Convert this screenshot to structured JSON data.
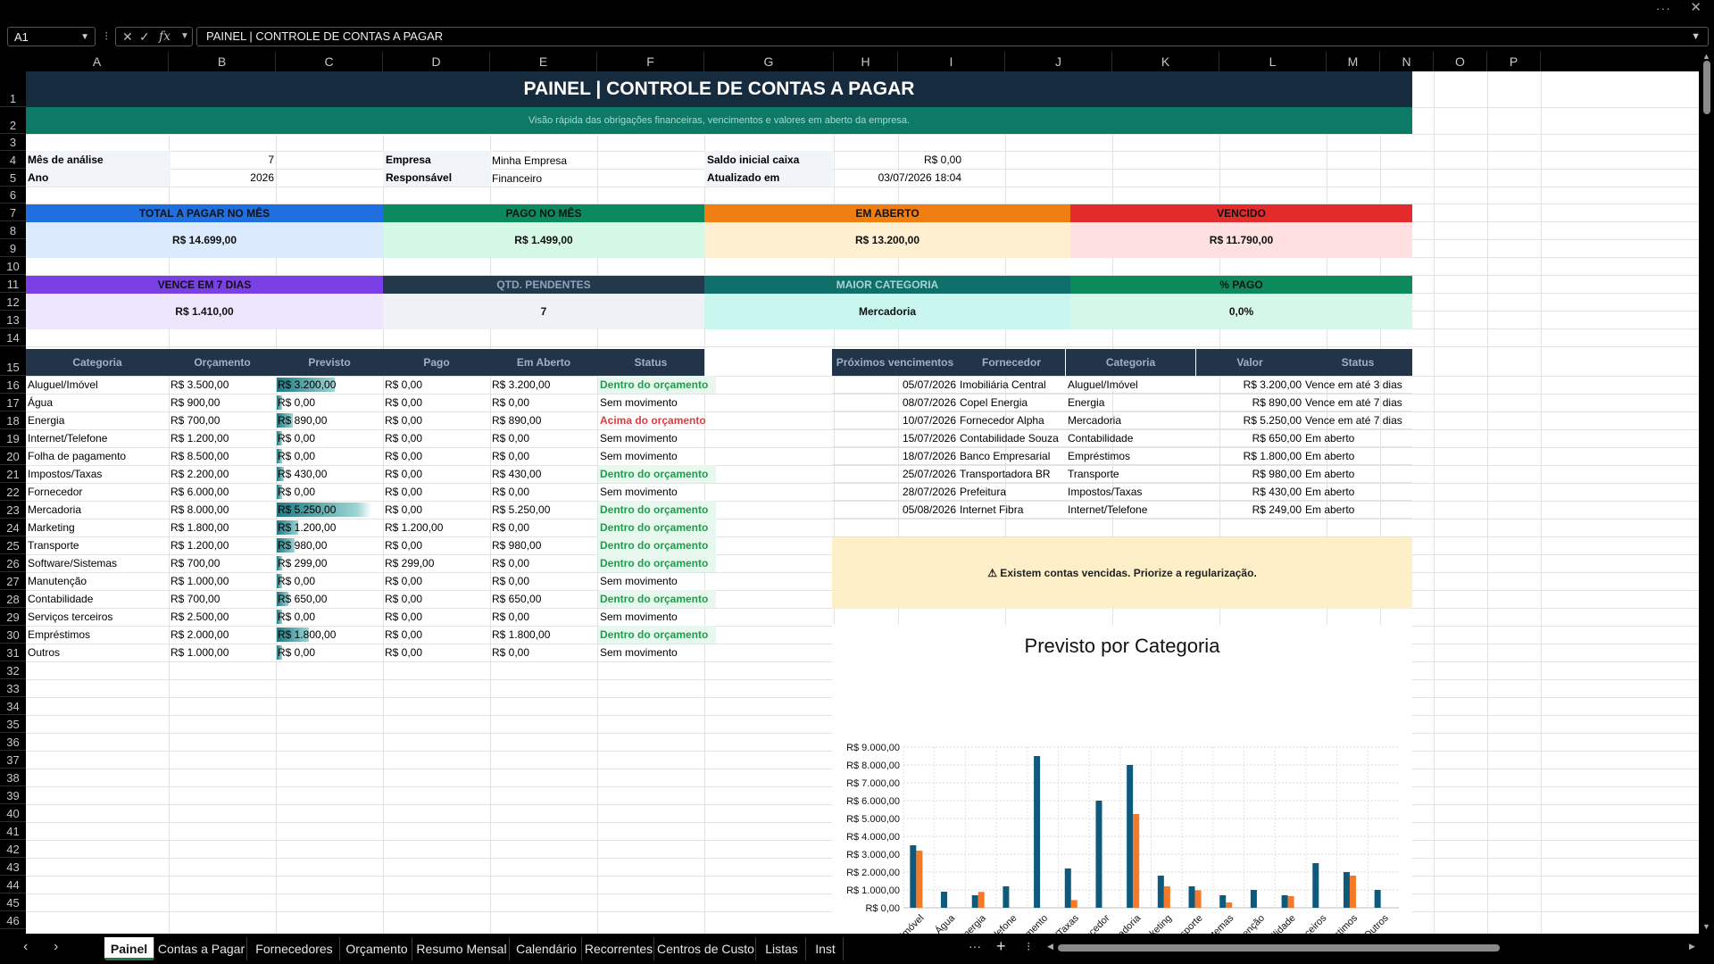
{
  "window": {
    "more_icon": "more-horizontal-icon",
    "close_icon": "close-icon"
  },
  "formula_bar": {
    "name_box": "A1",
    "fx_label": "fx",
    "formula": "PAINEL | CONTROLE DE CONTAS A PAGAR"
  },
  "columns": [
    "A",
    "B",
    "C",
    "D",
    "E",
    "F",
    "G",
    "H",
    "I",
    "J",
    "K",
    "L",
    "M",
    "N",
    "O",
    "P"
  ],
  "rows": [
    "1",
    "2",
    "3",
    "4",
    "5",
    "6",
    "7",
    "8",
    "9",
    "10",
    "11",
    "12",
    "13",
    "14",
    "15",
    "16",
    "17",
    "18",
    "19",
    "20",
    "21",
    "22",
    "23",
    "24",
    "25",
    "26",
    "27",
    "28",
    "29",
    "30",
    "31",
    "32",
    "33",
    "34",
    "35",
    "36",
    "37",
    "38",
    "39",
    "40",
    "41",
    "42",
    "43",
    "44",
    "45",
    "46"
  ],
  "sheet": {
    "title": "PAINEL | CONTROLE DE CONTAS A PAGAR",
    "subtitle": "Visão rápida das obrigações financeiras, vencimentos e valores em aberto da empresa.",
    "info": {
      "mes_label": "Mês de análise",
      "mes_value": "7",
      "ano_label": "Ano",
      "ano_value": "2026",
      "empresa_label": "Empresa",
      "empresa_value": "Minha Empresa",
      "responsavel_label": "Responsável",
      "responsavel_value": "Financeiro",
      "saldo_label": "Saldo inicial caixa",
      "saldo_value": "R$ 0,00",
      "atualizado_label": "Atualizado em",
      "atualizado_value": "03/07/2026 18:04"
    },
    "kpis_row1": [
      {
        "label": "TOTAL A PAGAR NO MÊS",
        "value": "R$ 14.699,00",
        "head_color": "#1f6fe0",
        "body_color": "#dbeafc"
      },
      {
        "label": "PAGO NO MÊS",
        "value": "R$ 1.499,00",
        "head_color": "#0c8a5f",
        "body_color": "#d4f7e6"
      },
      {
        "label": "EM ABERTO",
        "value": "R$ 13.200,00",
        "head_color": "#f07d12",
        "body_color": "#fdefcf"
      },
      {
        "label": "VENCIDO",
        "value": "R$ 11.790,00",
        "head_color": "#e42b2b",
        "body_color": "#fde0df"
      }
    ],
    "kpis_row2": [
      {
        "label": "VENCE EM 7 DIAS",
        "value": "R$ 1.410,00",
        "head_color": "#7b3fe6",
        "body_color": "#ede6fc"
      },
      {
        "label": "QTD. PENDENTES",
        "value": "7",
        "head_color": "#24384b",
        "body_color": "#eef2f6"
      },
      {
        "label": "MAIOR CATEGORIA",
        "value": "Mercadoria",
        "head_color": "#0f6f6a",
        "body_color": "#c9f6ef"
      },
      {
        "label": "% PAGO",
        "value": "0,0%",
        "head_color": "#0d8a5c",
        "body_color": "#d5f7e8"
      }
    ],
    "budget_table": {
      "headers": [
        "Categoria",
        "Orçamento",
        "Previsto",
        "Pago",
        "Em Aberto",
        "Status"
      ],
      "rows": [
        {
          "cat": "Aluguel/Imóvel",
          "orc": "R$ 3.500,00",
          "prev": "R$ 3.200,00",
          "pago": "R$ 0,00",
          "aberto": "R$ 3.200,00",
          "status": "Dentro do orçamento",
          "kind": "ok",
          "bar": 0.61
        },
        {
          "cat": "Água",
          "orc": "R$ 900,00",
          "prev": "R$ 0,00",
          "pago": "R$ 0,00",
          "aberto": "R$ 0,00",
          "status": "Sem movimento",
          "kind": "none",
          "bar": 0.0
        },
        {
          "cat": "Energia",
          "orc": "R$ 700,00",
          "prev": "R$ 890,00",
          "pago": "R$ 0,00",
          "aberto": "R$ 890,00",
          "status": "Acima do orçamento",
          "kind": "over",
          "bar": 0.17
        },
        {
          "cat": "Internet/Telefone",
          "orc": "R$ 1.200,00",
          "prev": "R$ 0,00",
          "pago": "R$ 0,00",
          "aberto": "R$ 0,00",
          "status": "Sem movimento",
          "kind": "none",
          "bar": 0.0
        },
        {
          "cat": "Folha de pagamento",
          "orc": "R$ 8.500,00",
          "prev": "R$ 0,00",
          "pago": "R$ 0,00",
          "aberto": "R$ 0,00",
          "status": "Sem movimento",
          "kind": "none",
          "bar": 0.0
        },
        {
          "cat": "Impostos/Taxas",
          "orc": "R$ 2.200,00",
          "prev": "R$ 430,00",
          "pago": "R$ 0,00",
          "aberto": "R$ 430,00",
          "status": "Dentro do orçamento",
          "kind": "ok",
          "bar": 0.08
        },
        {
          "cat": "Fornecedor",
          "orc": "R$ 6.000,00",
          "prev": "R$ 0,00",
          "pago": "R$ 0,00",
          "aberto": "R$ 0,00",
          "status": "Sem movimento",
          "kind": "none",
          "bar": 0.0
        },
        {
          "cat": "Mercadoria",
          "orc": "R$ 8.000,00",
          "prev": "R$ 5.250,00",
          "pago": "R$ 0,00",
          "aberto": "R$ 5.250,00",
          "status": "Dentro do orçamento",
          "kind": "ok",
          "bar": 1.0
        },
        {
          "cat": "Marketing",
          "orc": "R$ 1.800,00",
          "prev": "R$ 1.200,00",
          "pago": "R$ 1.200,00",
          "aberto": "R$ 0,00",
          "status": "Dentro do orçamento",
          "kind": "ok",
          "bar": 0.23
        },
        {
          "cat": "Transporte",
          "orc": "R$ 1.200,00",
          "prev": "R$ 980,00",
          "pago": "R$ 0,00",
          "aberto": "R$ 980,00",
          "status": "Dentro do orçamento",
          "kind": "ok",
          "bar": 0.19
        },
        {
          "cat": "Software/Sistemas",
          "orc": "R$ 700,00",
          "prev": "R$ 299,00",
          "pago": "R$ 299,00",
          "aberto": "R$ 0,00",
          "status": "Dentro do orçamento",
          "kind": "ok",
          "bar": 0.06
        },
        {
          "cat": "Manutenção",
          "orc": "R$ 1.000,00",
          "prev": "R$ 0,00",
          "pago": "R$ 0,00",
          "aberto": "R$ 0,00",
          "status": "Sem movimento",
          "kind": "none",
          "bar": 0.0
        },
        {
          "cat": "Contabilidade",
          "orc": "R$ 700,00",
          "prev": "R$ 650,00",
          "pago": "R$ 0,00",
          "aberto": "R$ 650,00",
          "status": "Dentro do orçamento",
          "kind": "ok",
          "bar": 0.12
        },
        {
          "cat": "Serviços terceiros",
          "orc": "R$ 2.500,00",
          "prev": "R$ 0,00",
          "pago": "R$ 0,00",
          "aberto": "R$ 0,00",
          "status": "Sem movimento",
          "kind": "none",
          "bar": 0.0
        },
        {
          "cat": "Empréstimos",
          "orc": "R$ 2.000,00",
          "prev": "R$ 1.800,00",
          "pago": "R$ 0,00",
          "aberto": "R$ 1.800,00",
          "status": "Dentro do orçamento",
          "kind": "ok",
          "bar": 0.34
        },
        {
          "cat": "Outros",
          "orc": "R$ 1.000,00",
          "prev": "R$ 0,00",
          "pago": "R$ 0,00",
          "aberto": "R$ 0,00",
          "status": "Sem movimento",
          "kind": "none",
          "bar": 0.0
        }
      ]
    },
    "due_table": {
      "headers": [
        "Próximos vencimentos",
        "Fornecedor",
        "Categoria",
        "Valor",
        "Status"
      ],
      "rows": [
        {
          "date": "05/07/2026",
          "forn": "Imobiliária Central",
          "cat": "Aluguel/Imóvel",
          "valor": "R$ 3.200,00",
          "status": "Vence em até 3 dias"
        },
        {
          "date": "08/07/2026",
          "forn": "Copel Energia",
          "cat": "Energia",
          "valor": "R$ 890,00",
          "status": "Vence em até 7 dias"
        },
        {
          "date": "10/07/2026",
          "forn": "Fornecedor Alpha",
          "cat": "Mercadoria",
          "valor": "R$ 5.250,00",
          "status": "Vence em até 7 dias"
        },
        {
          "date": "15/07/2026",
          "forn": "Contabilidade Souza",
          "cat": "Contabilidade",
          "valor": "R$ 650,00",
          "status": "Em aberto"
        },
        {
          "date": "18/07/2026",
          "forn": "Banco Empresarial",
          "cat": "Empréstimos",
          "valor": "R$ 1.800,00",
          "status": "Em aberto"
        },
        {
          "date": "25/07/2026",
          "forn": "Transportadora BR",
          "cat": "Transporte",
          "valor": "R$ 980,00",
          "status": "Em aberto"
        },
        {
          "date": "28/07/2026",
          "forn": "Prefeitura",
          "cat": "Impostos/Taxas",
          "valor": "R$ 430,00",
          "status": "Em aberto"
        },
        {
          "date": "05/08/2026",
          "forn": "Internet Fibra",
          "cat": "Internet/Telefone",
          "valor": "R$ 249,00",
          "status": "Em aberto"
        }
      ]
    },
    "alert": "⚠ Existem contas vencidas. Priorize a regularização."
  },
  "chart_data": {
    "type": "bar",
    "title": "Previsto por Categoria",
    "categories": [
      "Aluguel/Imóvel",
      "Água",
      "Energia",
      "Internet/Telefone",
      "Folha de pagamento",
      "Impostos/Taxas",
      "Fornecedor",
      "Mercadoria",
      "Marketing",
      "Transporte",
      "Software/Sistemas",
      "Manutenção",
      "Contabilidade",
      "Serviços terceiros",
      "Empréstimos",
      "Outros"
    ],
    "series": [
      {
        "color": "#0e5a7c",
        "values": [
          3500,
          900,
          700,
          1200,
          8500,
          2200,
          6000,
          8000,
          1800,
          1200,
          700,
          1000,
          700,
          2500,
          2000,
          1000
        ]
      },
      {
        "color": "#f47a2a",
        "values": [
          3200,
          0,
          890,
          0,
          0,
          430,
          0,
          5250,
          1200,
          980,
          299,
          0,
          650,
          0,
          1800,
          0
        ]
      }
    ],
    "ylim": [
      0,
      9000
    ],
    "yticks": [
      "R$ 0,00",
      "R$ 1.000,00",
      "R$ 2.000,00",
      "R$ 3.000,00",
      "R$ 4.000,00",
      "R$ 5.000,00",
      "R$ 6.000,00",
      "R$ 7.000,00",
      "R$ 8.000,00",
      "R$ 9.000,00"
    ],
    "grid": true
  },
  "tabs": {
    "prev_icon": "chevron-left-icon",
    "next_icon": "chevron-right-icon",
    "items": [
      "Painel",
      "Contas a Pagar",
      "Fornecedores",
      "Orçamento",
      "Resumo Mensal",
      "Calendário",
      "Recorrentes",
      "Centros de Custo",
      "Listas",
      "Inst"
    ],
    "active": "Painel",
    "add_icon": "plus-icon"
  }
}
